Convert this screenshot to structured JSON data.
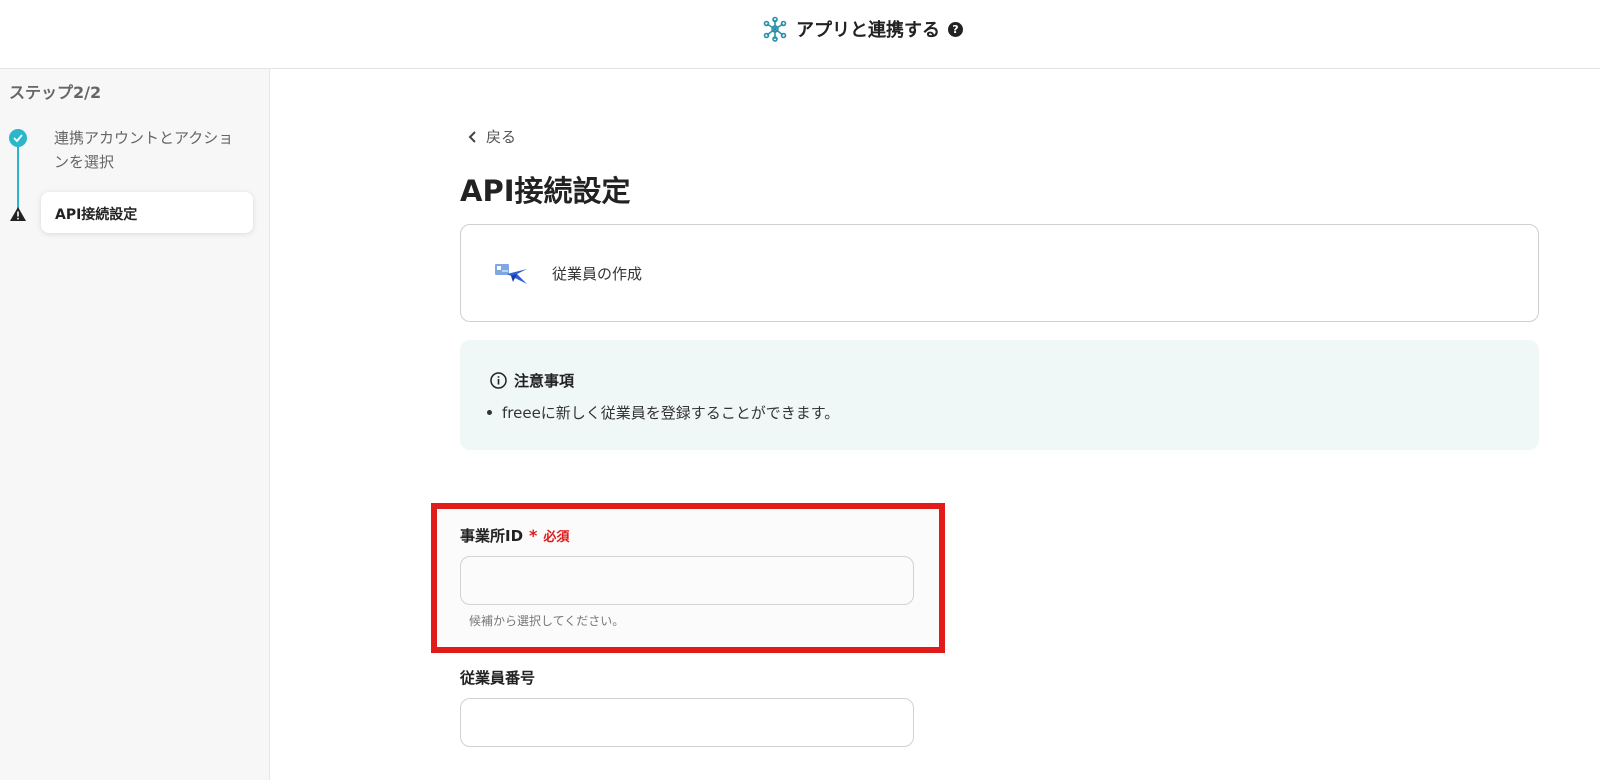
{
  "header": {
    "title": "アプリと連携する",
    "help_icon": "question-circle-icon",
    "app_icon": "network-nodes-icon"
  },
  "sidebar": {
    "step_count": "ステップ2/2",
    "steps": [
      {
        "label": "連携アカウントとアクションを選択",
        "status": "completed"
      },
      {
        "label": "API接続設定",
        "status": "current-warning"
      }
    ]
  },
  "main": {
    "back_label": "戻る",
    "page_title": "API接続設定",
    "action": {
      "label": "従業員の作成",
      "icon": "freee-app-icon"
    },
    "notice": {
      "title": "注意事項",
      "items": [
        "freeeに新しく従業員を登録することができます。"
      ]
    },
    "fields": [
      {
        "label": "事業所ID",
        "required_mark": "*",
        "required_text": "必須",
        "value": "",
        "hint": "候補から選択してください。"
      },
      {
        "label": "従業員番号",
        "value": ""
      }
    ]
  },
  "colors": {
    "accent": "#2bb6c9",
    "highlight": "#e11a1a",
    "notice_bg": "#f0f8f7"
  }
}
